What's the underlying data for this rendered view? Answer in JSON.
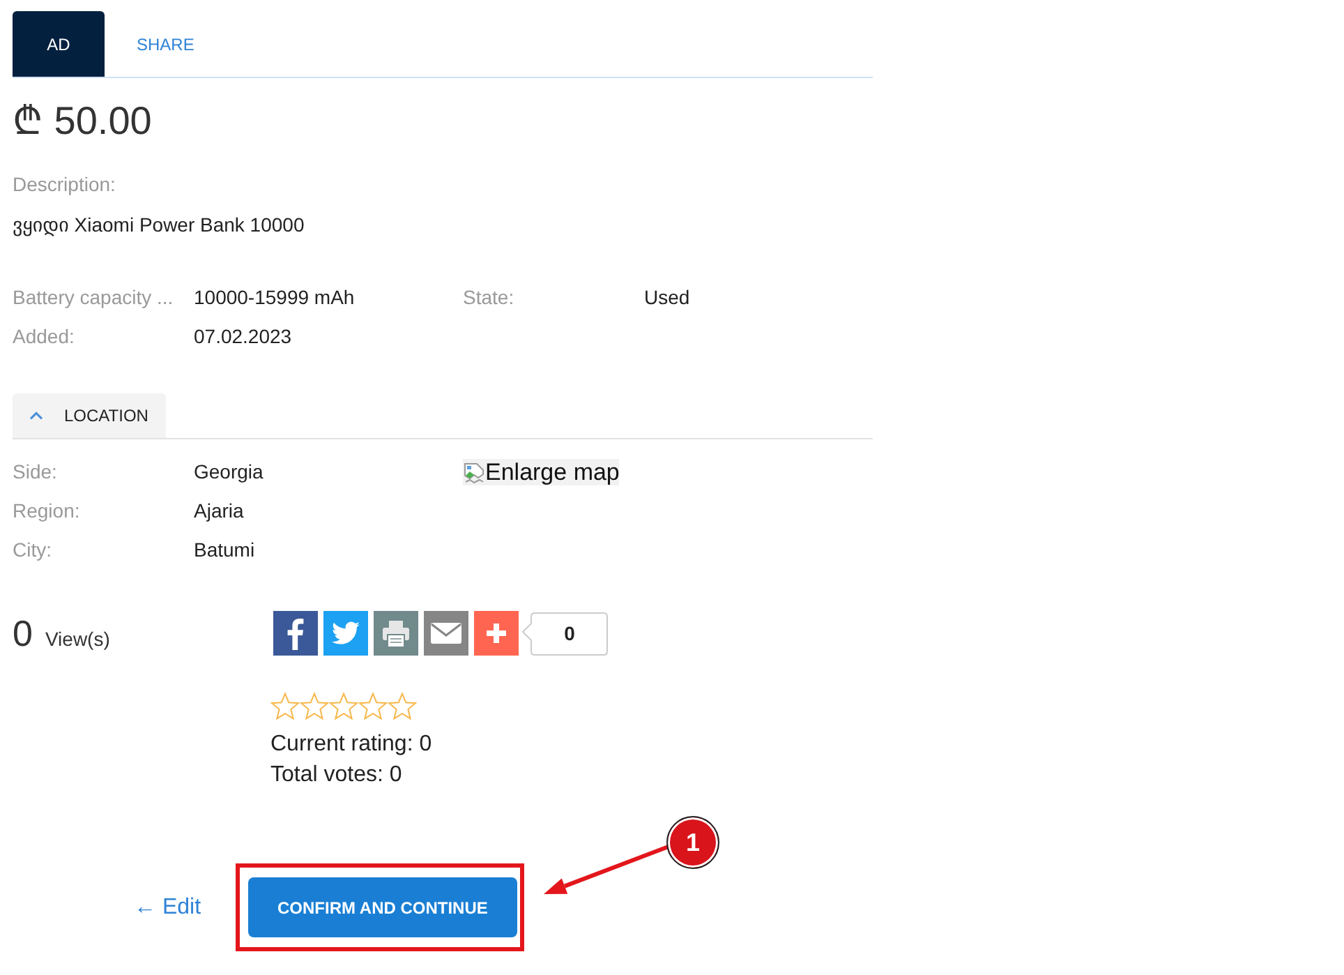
{
  "tabs": [
    {
      "label": "AD",
      "selected": true
    },
    {
      "label": "SHARE",
      "selected": false
    }
  ],
  "price": "₾ 50.00",
  "description": {
    "label": "Description:",
    "text": "ვყიდი Xiaomi Power Bank 10000"
  },
  "details": [
    {
      "label": "Battery capacity ...",
      "value": "10000-15999 mAh"
    },
    {
      "label": "State:",
      "value": "Used"
    },
    {
      "label": "Added:",
      "value": "07.02.2023"
    }
  ],
  "location": {
    "section": {
      "label": "LOCATION",
      "expanded": true
    },
    "fields": [
      {
        "label": "Side:",
        "value": "Georgia"
      },
      {
        "label": "Region:",
        "value": "Ajaria"
      },
      {
        "label": "City:",
        "value": "Batumi"
      }
    ],
    "map": {
      "alt": "Enlarge map"
    }
  },
  "views": {
    "count": "0",
    "label": "View(s)"
  },
  "share": {
    "buttons": [
      {
        "kind": "facebook"
      },
      {
        "kind": "twitter"
      },
      {
        "kind": "print"
      },
      {
        "kind": "email"
      },
      {
        "kind": "more"
      }
    ],
    "count": "0"
  },
  "rating": {
    "stars": 0,
    "current": "Current rating: 0",
    "votes": "Total votes: 0"
  },
  "actions": {
    "edit": "← Edit",
    "confirm": "CONFIRM AND CONTINUE"
  },
  "annotation": {
    "badge": "1"
  }
}
